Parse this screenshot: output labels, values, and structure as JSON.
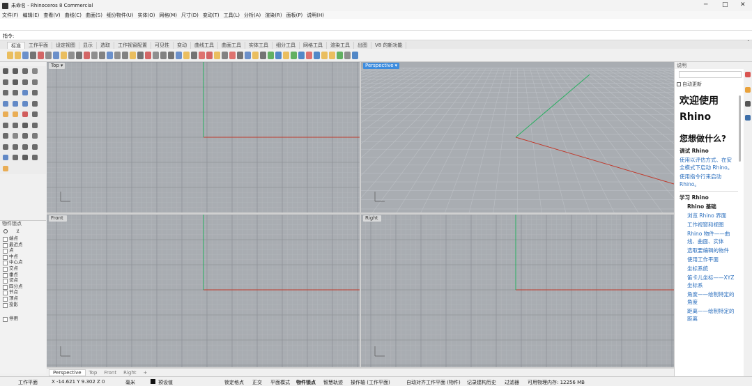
{
  "title": "未命名 - Rhinoceros 8 Commercial",
  "menu": [
    "文件(F)",
    "编辑(E)",
    "查看(V)",
    "曲线(C)",
    "曲面(S)",
    "细分物件(U)",
    "实体(O)",
    "网格(M)",
    "尺寸(D)",
    "变动(T)",
    "工具(L)",
    "分析(A)",
    "渲染(R)",
    "面板(P)",
    "说明(H)"
  ],
  "command": {
    "prompt": "指令:",
    "scroll_up": "▲",
    "scroll_down": "▼"
  },
  "tabs": [
    "标准",
    "工作平面",
    "设定视图",
    "显示",
    "选取",
    "工作视窗配置",
    "可见性",
    "变动",
    "曲线工具",
    "曲面工具",
    "实体工具",
    "细分工具",
    "网格工具",
    "渲染工具",
    "出图",
    "V8 的新功能"
  ],
  "viewports": [
    {
      "label": "Top",
      "arrow": "▾",
      "active": false
    },
    {
      "label": "Perspective",
      "arrow": "▾",
      "active": true
    },
    {
      "label": "Front",
      "arrow": "",
      "active": false
    },
    {
      "label": "Right",
      "arrow": "",
      "active": false
    }
  ],
  "viewport_tabs": [
    "Perspective",
    "Top",
    "Front",
    "Right",
    "+"
  ],
  "layer_panel": {
    "title": "物件锁点",
    "items": [
      "端点",
      "最近点",
      "点",
      "中点",
      "中心点",
      "交点",
      "垂点",
      "切点",
      "四分点",
      "节点",
      "顶点",
      "投影",
      "停用"
    ]
  },
  "right_panel": {
    "title": "说明",
    "auto_update": "自动更新",
    "welcome_line1": "欢迎使用",
    "welcome_line2": "Rhino",
    "question": "您想做什么?",
    "section_rhino": "调试 Rhino",
    "links_rhino": [
      "使用以评估方式、在安全模式下启动 Rhino。",
      "使用指令行来启动 Rhino。"
    ],
    "section_learn": "学习 Rhino",
    "subsection": "Rhino 基础",
    "links_learn": [
      "浏览 Rhino 界面",
      "工作视窗和视图",
      "Rhino 物件——曲线、曲面、实体",
      "选取要编辑的物件",
      "使用工作平面",
      "坐标系统",
      "笛卡儿坐标——XYZ坐标系",
      "角度——绘制特定的角度",
      "距离——绘制特定的距离"
    ]
  },
  "statusbar": {
    "cplane": "工作平面",
    "coords": "X -14.621 Y 9.302 Z 0",
    "units": "毫米",
    "layer": "预设值",
    "toggles": [
      "锁定格点",
      "正交",
      "平面模式",
      "物件锁点",
      "智慧轨迹",
      "操作轴 (工作平面)",
      "自动对齐工作平面 (物件)",
      "记录建构历史",
      "过滤器"
    ],
    "memory": "可用物理内存: 12256 MB"
  },
  "colors": {
    "accent": "#3d8cde",
    "x_axis": "#c0392b",
    "y_axis": "#27ae60",
    "viewport_bg": "#a9adb2",
    "link": "#2a6ebd"
  }
}
